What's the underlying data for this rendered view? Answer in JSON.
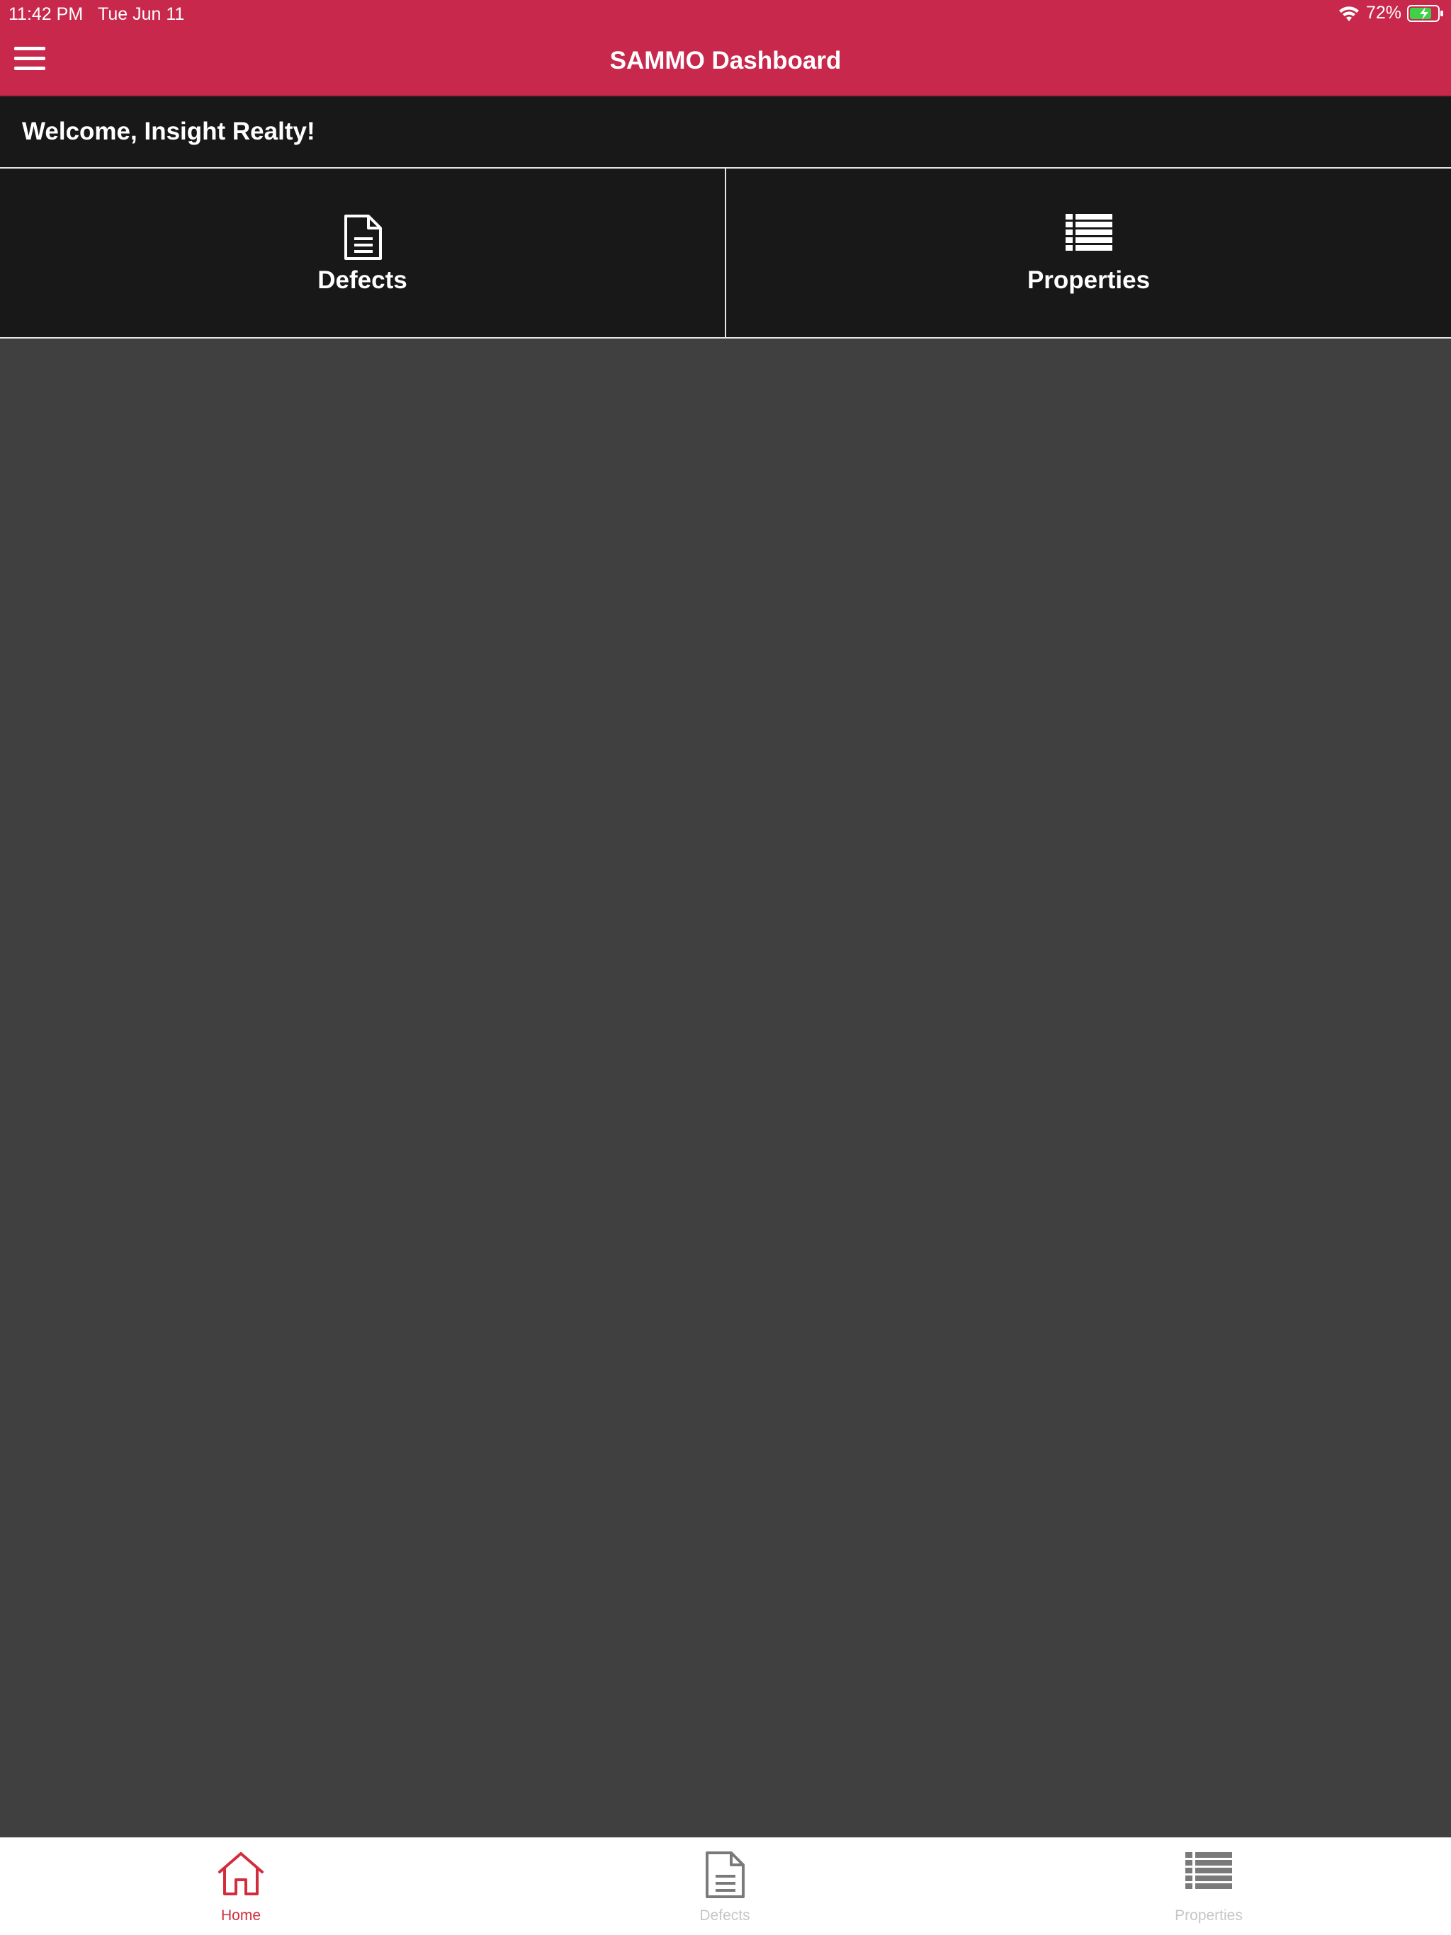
{
  "status_bar": {
    "time": "11:42 PM",
    "date": "Tue Jun 11",
    "battery": "72%",
    "icons": [
      "wifi-icon",
      "battery-charging-icon"
    ]
  },
  "navbar": {
    "title": "SAMMO Dashboard",
    "menu_icon": "hamburger-icon"
  },
  "welcome": {
    "text": "Welcome, Insight Realty!"
  },
  "tiles": [
    {
      "label": "Defects",
      "icon": "document-icon"
    },
    {
      "label": "Properties",
      "icon": "list-icon"
    }
  ],
  "tabbar": {
    "tabs": [
      {
        "label": "Home",
        "icon": "home-icon",
        "active": true
      },
      {
        "label": "Defects",
        "icon": "document-icon",
        "active": false
      },
      {
        "label": "Properties",
        "icon": "list-icon",
        "active": false
      }
    ]
  },
  "colors": {
    "brand": "#c8284c",
    "panel": "#181818",
    "background": "#404040",
    "active_tab": "#d22d3c",
    "inactive_tab": "#c6c6c6"
  }
}
